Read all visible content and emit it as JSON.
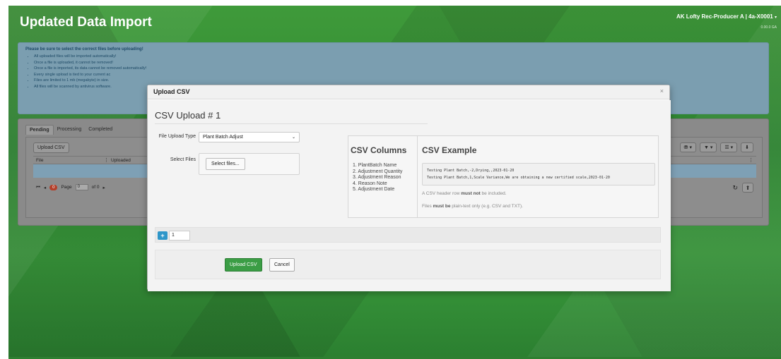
{
  "app": {
    "title": "Updated Data Import",
    "user_name": "AK Lofty Rec-Producer A | 4a-X0001",
    "user_caret": "▾",
    "version": "0.00.0 GA"
  },
  "notice": {
    "title": "Please be sure to select the correct files before uploading!",
    "items": [
      "All uploaded files will be imported automatically!",
      "Once a file is uploaded, it cannot be removed!",
      "Once a file is imported, its data cannot be removed automatically!",
      "Every single upload is tied to your current ac",
      "Files are limited to 1 mb (megabyte) in size.",
      "All files will be scanned by antivirus software."
    ]
  },
  "grid": {
    "tabs": [
      "Pending",
      "Processing",
      "Completed"
    ],
    "upload_button": "Upload CSV",
    "col_file": "File",
    "col_uploaded": "Uploaded",
    "col_sep": "⋮",
    "pager": {
      "first": "⏮",
      "prev": "◂",
      "count": "0",
      "page_label": "Page",
      "page_value": "0",
      "of_label": "of 0",
      "next": "▸"
    },
    "tools": [
      "⛃ ▾",
      "▼ ▾",
      "☰ ▾",
      "⬇"
    ],
    "refresh_icon": "↻",
    "refresh_button": "⬆"
  },
  "modal": {
    "title": "Upload CSV",
    "close": "×",
    "section_title": "CSV Upload # 1",
    "upload_type_label": "File Upload Type",
    "upload_type_value": "Plant Batch Adjust",
    "upload_type_chevron": "⌄",
    "select_files_label": "Select Files",
    "select_files_button": "Select files...",
    "csv_columns_title": "CSV Columns",
    "csv_columns": [
      "1. PlantBatch Name",
      "2. Adjustment Quantity",
      "3. Adjustment Reason",
      "4. Reason Note",
      "5. Adjustment Date"
    ],
    "csv_example_title": "CSV Example",
    "csv_example_lines": [
      "Testing Plant Batch,-2,Drying,,2023-01-20",
      "Testing Plant Batch,1,Scale Variance,We are obtaining a new certified scale,2023-01-20"
    ],
    "note_header_prefix": "A CSV header row ",
    "note_header_bold": "must not",
    "note_header_suffix": " be included.",
    "note_files_prefix": "Files ",
    "note_files_bold": "must be",
    "note_files_suffix": " plain-text only (e.g. CSV and TXT).",
    "add_button": "+",
    "count_value": "1",
    "upload_button": "Upload CSV",
    "cancel_button": "Cancel"
  }
}
